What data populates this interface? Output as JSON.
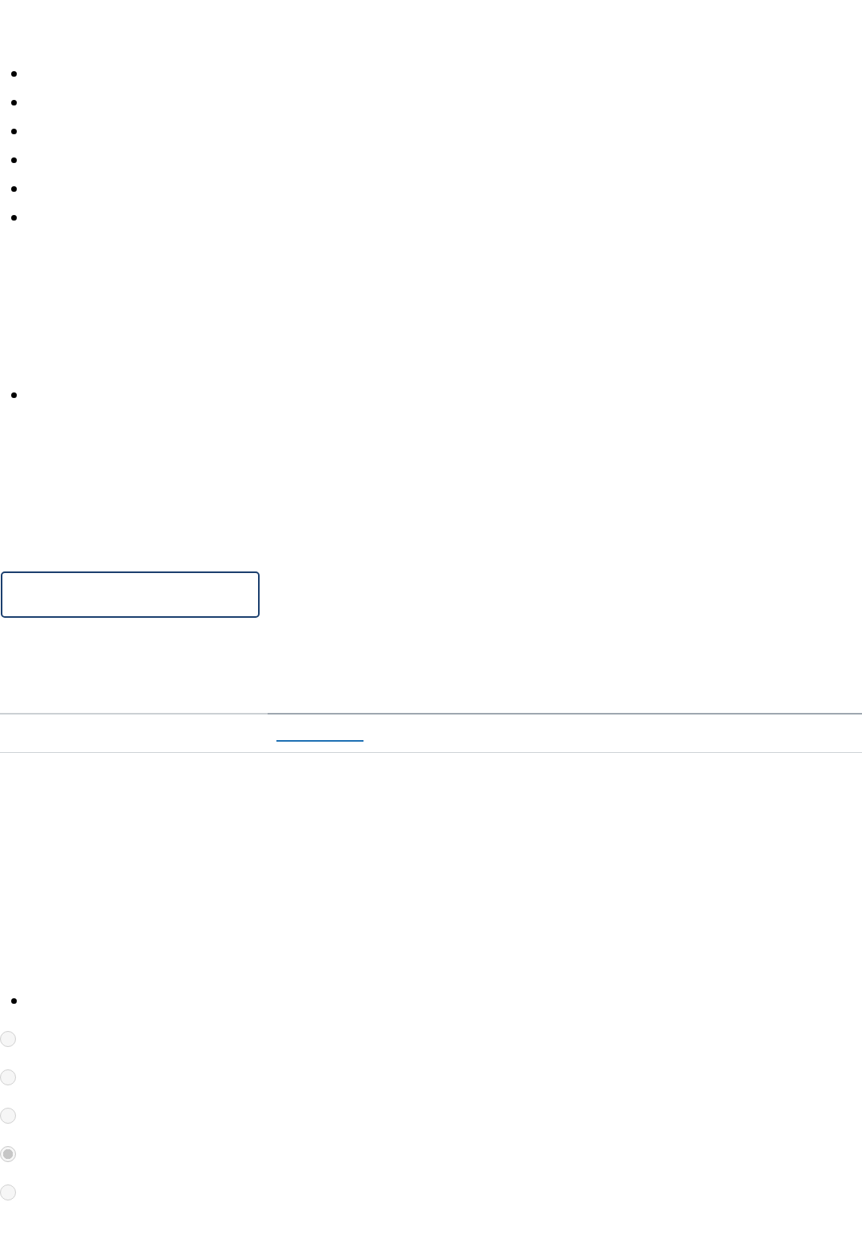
{
  "bullet_list_1": [
    {
      "kind": "bullet"
    },
    {
      "kind": "bullet"
    },
    {
      "kind": "bullet"
    },
    {
      "kind": "bullet"
    },
    {
      "kind": "bullet"
    },
    {
      "kind": "bullet"
    }
  ],
  "bullet_list_2": [
    {
      "kind": "bullet"
    }
  ],
  "text_field": {
    "focused": true
  },
  "tabs": [
    {
      "selected": false
    },
    {
      "selected": true
    }
  ],
  "bullet_list_3": [
    {
      "kind": "bullet"
    }
  ],
  "radio_group": [
    {
      "selected": false,
      "disabled": true
    },
    {
      "selected": false,
      "disabled": true
    },
    {
      "selected": false,
      "disabled": true
    },
    {
      "selected": true,
      "disabled": true
    },
    {
      "selected": false,
      "disabled": true
    }
  ]
}
